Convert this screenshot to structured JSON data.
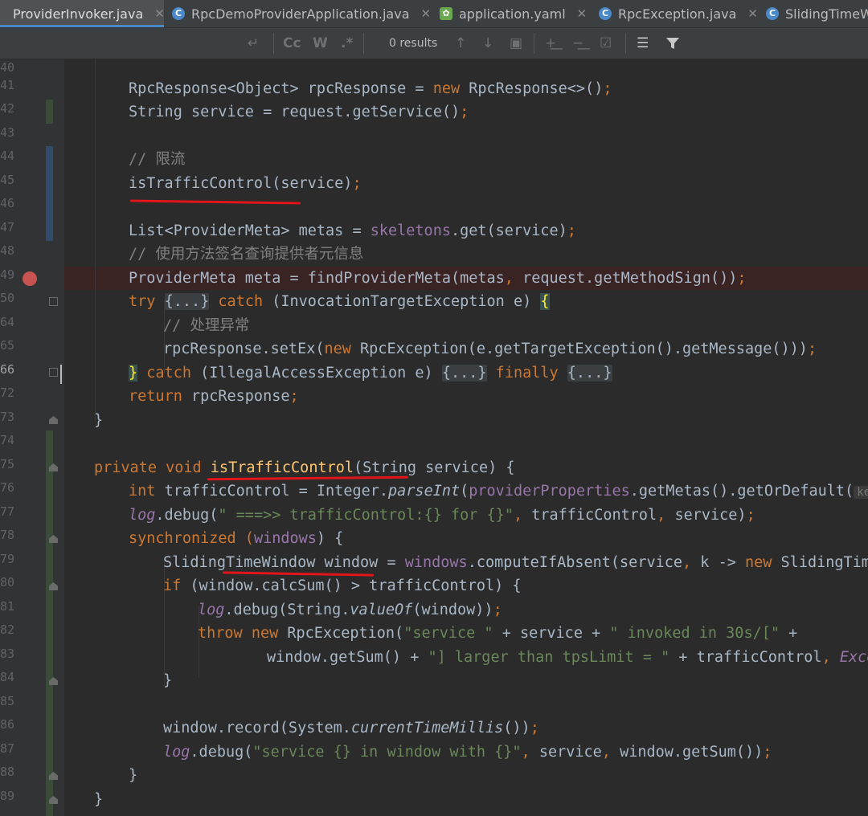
{
  "tabs": [
    {
      "label": "ProviderInvoker.java",
      "active": true
    },
    {
      "label": "RpcDemoProviderApplication.java",
      "active": false
    },
    {
      "label": "application.yaml",
      "active": false
    },
    {
      "label": "RpcException.java",
      "active": false
    },
    {
      "label": "SlidingTimeWindow",
      "active": false
    }
  ],
  "find": {
    "cc": "Cc",
    "w": "W",
    "regex": ".*",
    "results": "0 results"
  },
  "gutter": {
    "lines": [
      "40",
      "41",
      "42",
      "43",
      "44",
      "45",
      "46",
      "47",
      "48",
      "49",
      "50",
      "64",
      "65",
      "66",
      "72",
      "73",
      "74",
      "75",
      "76",
      "77",
      "78",
      "79",
      "80",
      "81",
      "82",
      "83",
      "84",
      "85",
      "86",
      "87",
      "88",
      "89"
    ]
  },
  "code": {
    "l41a": "RpcResponse<Object> rpcResponse = ",
    "l41b": "new",
    "l41c": " RpcResponse<>()",
    "l41d": ";",
    "l42a": "String service = request.getService()",
    "l42b": ";",
    "l44": "// 限流",
    "l45a": "isTrafficControl(service)",
    "l45b": ";",
    "l47a": "List<ProviderMeta> metas = ",
    "l47b": "skeletons",
    ".l47c": "",
    "l47c": ".get(service)",
    "l47d": ";",
    "l48": "// 使用方法签名查询提供者元信息",
    "l49a": "ProviderMeta meta = findProviderMeta(metas",
    "l49b": ",",
    "l49c": " request.getMethodSign())",
    "l49d": ";",
    "l50a": "try ",
    "l50b": "{...}",
    "l50c": " catch ",
    "l50d": "(InvocationTargetException e) ",
    "l50e": "{",
    "l64": "// 处理异常",
    "l65a": "rpcResponse.setEx(",
    "l65b": "new",
    "l65c": " RpcException(e.getTargetException().getMessage()))",
    "l65d": ";",
    "l66a": "}",
    "l66b": " catch ",
    "l66c": "(IllegalAccessException e) ",
    "l66d": "{...}",
    "l66e": " finally ",
    "l66f": "{...}",
    "l72a": "return ",
    "l72b": "rpcResponse",
    "l72c": ";",
    "l73": "}",
    "l75a": "private void ",
    "l75b": "isTrafficControl",
    "l75c": "(String service) {",
    "l76a": "int ",
    "l76b": "trafficControl = Integer.",
    "l76c": "parseInt",
    "l76d": "(",
    "l76e": "providerProperties",
    "l76f": ".getMetas().getOrDefault(",
    "l76g": "key:",
    "l77a": "log",
    ".l77": "",
    "l77b": ".debug(",
    "l77c": "\" ===>> trafficControl:{} for {}\"",
    "l77d": ", ",
    "l77e": "trafficControl",
    "l77f": ", ",
    "l77g": "service)",
    "l77h": ";",
    "l78a": "synchronized ",
    "l78b": "(",
    "l78c": "windows",
    "l78d": ") {",
    "l79a": "SlidingTimeWindow window = ",
    "l79b": "windows",
    "l79c": ".computeIfAbsent(service",
    "l79d": ",",
    "l79e": " k -> ",
    "l79f": "new",
    "l79g": " SlidingTimeWi",
    "l80a": "if ",
    "l80b": "(window.calcSum() > trafficControl) {",
    "l81a": "log",
    "l81b": ".debug(String.",
    "l81c": "valueOf",
    "l81d": "(window))",
    "l81e": ";",
    "l82a": "throw new ",
    "l82b": "RpcException(",
    "l82c": "\"service \"",
    "l82d": " + service + ",
    "l82e": "\" invoked in 30s/[\"",
    "l82f": " +",
    "l83a": "window.getSum() + ",
    "l83b": "\"] larger than tpsLimit = \"",
    "l83c": " + trafficControl",
    "l83d": ", ",
    "l83e": "Exceed",
    "l84": "}",
    "l86a": "window.record(System.",
    "l86b": "currentTimeMillis",
    "l86c": "())",
    "l86d": ";",
    "l87a": "log",
    "l87b": ".debug(",
    "l87c": "\"service {} in window with {}\"",
    "l87d": ", ",
    "l87e": "service",
    "l87f": ", ",
    "l87g": "window.getSum())",
    "l87h": ";",
    "l88": "}",
    "l89": "}"
  },
  "colors": {
    "keyword": "#cc7832",
    "comment": "#808080",
    "string": "#6a8759",
    "field": "#9876aa",
    "method": "#ffc66d",
    "breakpoint": "#c75450",
    "annotation_red": "#e0151b"
  }
}
